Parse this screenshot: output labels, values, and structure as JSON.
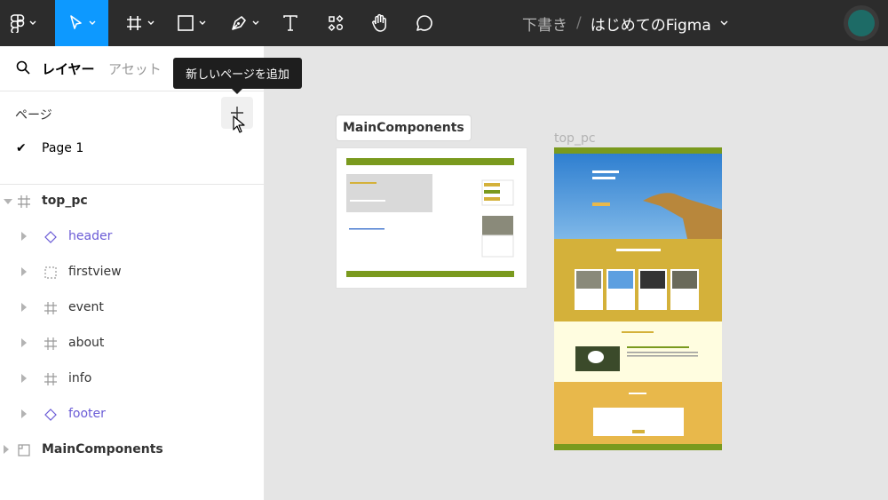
{
  "toolbar": {
    "tools": [
      "figma-menu",
      "move",
      "frame",
      "shape",
      "pen",
      "text",
      "resources",
      "hand",
      "comment"
    ],
    "active_tool": "move",
    "accent": "#0d99ff"
  },
  "file": {
    "folder": "下書き",
    "separator": "/",
    "name": "はじめてのFigma"
  },
  "avatar": {
    "color": "#1d6b66"
  },
  "left_panel": {
    "tab_layers": "レイヤー",
    "tab_assets": "アセット",
    "pages_heading": "ページ",
    "current_page": "Page 1",
    "layers": [
      {
        "name": "top_pc",
        "type": "frame",
        "expanded": true
      },
      {
        "name": "header",
        "type": "instance"
      },
      {
        "name": "firstview",
        "type": "section"
      },
      {
        "name": "event",
        "type": "frame"
      },
      {
        "name": "about",
        "type": "frame"
      },
      {
        "name": "info",
        "type": "frame"
      },
      {
        "name": "footer",
        "type": "instance"
      },
      {
        "name": "MainComponents",
        "type": "page-frame"
      }
    ]
  },
  "tooltip": "新しいページを追加",
  "canvas": {
    "main_components_label": "MainComponents",
    "top_pc_label": "top_pc",
    "colors": {
      "green": "#7a9a1e",
      "sky": "#3d8fd6",
      "mustard": "#d4b13a",
      "cream": "#fffde0",
      "orange": "#e8b84b"
    }
  }
}
